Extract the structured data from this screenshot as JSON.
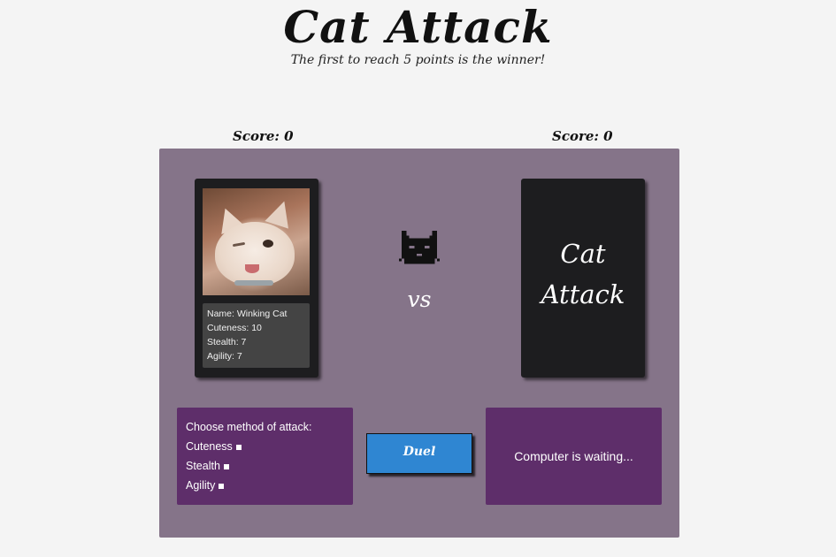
{
  "header": {
    "title": "Cat Attack",
    "subtitle": "The first to reach 5 points is the winner!"
  },
  "scores": {
    "player": "Score: 0",
    "computer": "Score: 0"
  },
  "player_card": {
    "stats": {
      "name": "Name: Winking Cat",
      "cuteness": "Cuteness: 10",
      "stealth": "Stealth: 7",
      "agility": "Agility: 7"
    }
  },
  "computer_card": {
    "back_line1": "Cat",
    "back_line2": "Attack"
  },
  "center": {
    "icon": "cat-face-icon",
    "vs_label": "vs"
  },
  "attack_panel": {
    "prompt": "Choose method of attack:",
    "options": [
      "Cuteness",
      "Stealth",
      "Agility"
    ]
  },
  "duel_button": {
    "label": "Duel"
  },
  "computer_panel": {
    "status": "Computer is waiting..."
  },
  "colors": {
    "board": "#857489",
    "panel": "#5e2e6a",
    "card": "#1d1d1f",
    "duel_button": "#2f86d2",
    "background": "#f4f4f4"
  }
}
